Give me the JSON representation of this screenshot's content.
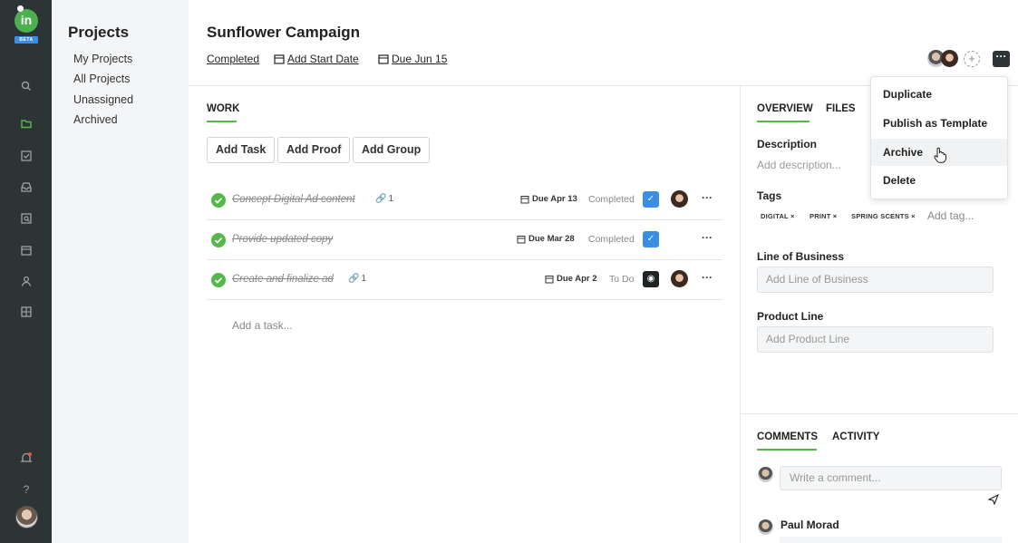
{
  "app": {
    "logo_text": "in",
    "beta_badge": "BETA"
  },
  "rail": {
    "icons": [
      "search-icon",
      "folder-icon",
      "checkbox-icon",
      "inbox-icon",
      "proof-icon",
      "calendar-icon",
      "person-icon",
      "layout-icon",
      "notification-icon",
      "help-icon"
    ],
    "help_label": "?"
  },
  "nav": {
    "title": "Projects",
    "items": [
      "My Projects",
      "All Projects",
      "Unassigned",
      "Archived"
    ]
  },
  "header": {
    "title": "Sunflower Campaign",
    "status": "Completed",
    "start_date": "Add Start Date",
    "due_date": "Due Jun 15",
    "add_person": "+",
    "more": "···"
  },
  "work": {
    "tab": "WORK",
    "buttons": [
      "Add Task",
      "Add Proof",
      "Add Group"
    ],
    "tasks": [
      {
        "name": "Concept Digital Ad content",
        "links": "1",
        "due": "Due Apr 13",
        "status": "Completed",
        "more": "···"
      },
      {
        "name": "Provide updated copy",
        "links": "",
        "due": "Due Mar 28",
        "status": "Completed",
        "more": "···"
      },
      {
        "name": "Create and finalize ad",
        "links": "1",
        "due": "Due Apr 2",
        "status": "To Do",
        "more": "···"
      }
    ],
    "add_task_placeholder": "Add a task..."
  },
  "details": {
    "tabs": [
      "OVERVIEW",
      "FILES"
    ],
    "description_label": "Description",
    "description_placeholder": "Add description...",
    "tags_label": "Tags",
    "tags": [
      "DIGITAL ×",
      "PRINT ×",
      "SPRING SCENTS ×"
    ],
    "add_tag_placeholder": "Add tag...",
    "line_of_business_label": "Line of Business",
    "line_of_business_placeholder": "Add Line of Business",
    "product_line_label": "Product Line",
    "product_line_placeholder": "Add Product Line"
  },
  "comments": {
    "tabs": [
      "COMMENTS",
      "ACTIVITY"
    ],
    "input_placeholder": "Write a comment...",
    "commenter": "Paul Morad"
  },
  "menu": {
    "items": [
      "Duplicate",
      "Publish as Template",
      "Archive",
      "Delete"
    ],
    "hovered": "Archive"
  },
  "colors": {
    "rail_bg": "#2d3436",
    "accent_green": "#55b94a",
    "proof_blue": "#3a8ee6",
    "nav_bg": "#f4f5f6"
  }
}
